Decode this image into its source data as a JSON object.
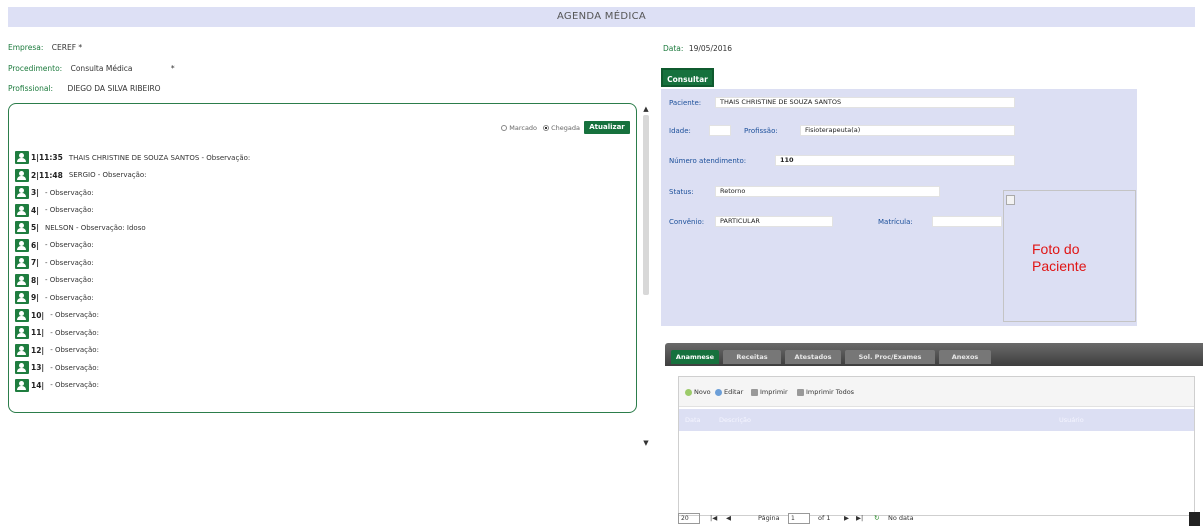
{
  "title": "AGENDA MÉDICA",
  "filters": {
    "empresa_label": "Empresa:",
    "empresa_value": "CEREF *",
    "procedimento_label": "Procedimento:",
    "procedimento_value": "Consulta Médica",
    "procedimento_marker": "*",
    "profissional_label": "Profissional:",
    "profissional_value": "DIEGO DA SILVA RIBEIRO"
  },
  "date": {
    "label": "Data:",
    "value": "19/05/2016"
  },
  "list_controls": {
    "radio_marcado": "Marcado",
    "radio_chegada": "Chegada",
    "selected": "Chegada",
    "button": "Atualizar"
  },
  "patients": [
    {
      "num": "1|11:35",
      "text": "THAIS CHRISTINE DE SOUZA SANTOS - Observação:"
    },
    {
      "num": "2|11:48",
      "text": "SERGIO - Observação:"
    },
    {
      "num": "3|",
      "text": "- Observação:"
    },
    {
      "num": "4|",
      "text": "- Observação:"
    },
    {
      "num": "5|",
      "text": "NELSON - Observação: Idoso"
    },
    {
      "num": "6|",
      "text": "- Observação:"
    },
    {
      "num": "7|",
      "text": "- Observação:"
    },
    {
      "num": "8|",
      "text": "- Observação:"
    },
    {
      "num": "9|",
      "text": "- Observação:"
    },
    {
      "num": "10|",
      "text": "- Observação:"
    },
    {
      "num": "11|",
      "text": "- Observação:"
    },
    {
      "num": "12|",
      "text": "- Observação:"
    },
    {
      "num": "13|",
      "text": "- Observação:"
    },
    {
      "num": "14|",
      "text": "- Observação:"
    }
  ],
  "consultar_tab": "Consultar",
  "patient_form": {
    "paciente_label": "Paciente:",
    "paciente_value": "THAIS CHRISTINE DE SOUZA SANTOS",
    "idade_label": "Idade:",
    "idade_value": "",
    "profissao_label": "Profissão:",
    "profissao_value": "Fisioterapeuta(a)",
    "atendimento_label": "Número atendimento:",
    "atendimento_value": "110",
    "status_label": "Status:",
    "status_value": "Retorno",
    "convenio_label": "Convênio:",
    "convenio_value": "PARTICULAR",
    "matricula_label": "Matrícula:",
    "matricula_value": "",
    "photo_text": "Foto do Paciente"
  },
  "lower_tabs": [
    "Anamnese",
    "Receitas",
    "Atestados",
    "Sol. Proc/Exames",
    "Anexos"
  ],
  "active_tab": "Anamnese",
  "grid_toolbar": {
    "novo": "Novo",
    "editar": "Editar",
    "imprimir": "Imprimir",
    "imprimir_todos": "Imprimir Todos"
  },
  "grid_headers": [
    "Data",
    "Descrição",
    "Usuário"
  ],
  "pager": {
    "page_size": "20",
    "page_label": "Página",
    "page_value": "1",
    "of_label": "of 1",
    "empty": "No data"
  },
  "colors": {
    "accent": "#16713d",
    "panel": "#dcdff3",
    "photo_text": "#e01515"
  }
}
